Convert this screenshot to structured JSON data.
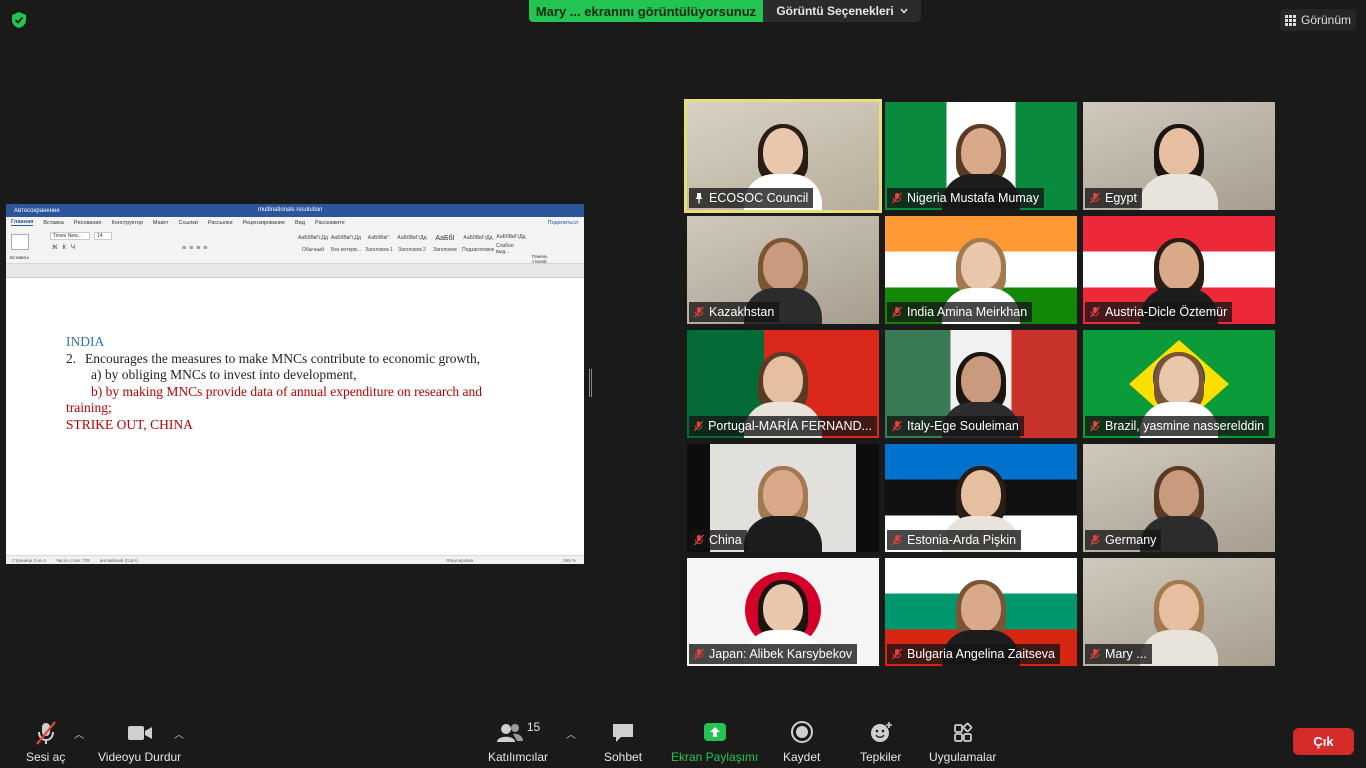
{
  "top": {
    "share_status": "Mary ... ekranını görüntülüyorsunuz",
    "view_options": "Görüntü Seçenekleri",
    "view_button": "Görünüm"
  },
  "document": {
    "filename": "multinationals resolution",
    "autosave": "Автосохранение",
    "tabs": [
      "Главная",
      "Вставка",
      "Рисование",
      "Конструктор",
      "Макет",
      "Ссылки",
      "Рассылки",
      "Рецензирование",
      "Вид",
      "Расскажите"
    ],
    "share_label": "Поделиться",
    "font_name": "Times New...",
    "font_size": "14",
    "styles": [
      {
        "preview": "АаБбВвГг,Дд",
        "name": "Обычный"
      },
      {
        "preview": "АаБбВвГг,Дд",
        "name": "Без интерв..."
      },
      {
        "preview": "АаБбВвГ:",
        "name": "Заголовок 1"
      },
      {
        "preview": "АаБбВвГгДд",
        "name": "Заголовок 2"
      },
      {
        "preview": "АаБбI",
        "name": "Заголовок"
      },
      {
        "preview": "АаБбВвГгДд",
        "name": "Подзаголовок"
      },
      {
        "preview": "АаБбВвГгДд",
        "name": "Слабое выд..."
      }
    ],
    "styles_pane": "Панель стилей",
    "paste_label": "Вставить",
    "status_left": "Страница 2 из 4",
    "status_words": "Число слов: 728",
    "status_lang": "английский (США)",
    "status_focus": "Фокусировка",
    "status_zoom": "265 %",
    "content": {
      "heading": "INDIA",
      "item_number": "2.",
      "item_text": "Encourages the measures to make MNCs contribute to economic growth,",
      "sub_a": "a) by obliging MNCs to invest into development,",
      "sub_b_line1": "b) by making MNCs provide data of annual expenditure on research and",
      "sub_b_line2": "training;",
      "strike_note": "STRIKE OUT, CHINA"
    }
  },
  "participants": [
    {
      "name": "ECOSOC Council",
      "pinned": true,
      "active": true
    },
    {
      "name": "Nigeria Mustafa Mumay",
      "flag": "nigeria"
    },
    {
      "name": "Egypt",
      "flag": "room"
    },
    {
      "name": "Kazakhstan",
      "flag": "room"
    },
    {
      "name": "India Amina Meirkhan",
      "flag": "india"
    },
    {
      "name": "Austria-Dicle Öztemür",
      "flag": "austria"
    },
    {
      "name": "Portugal-MARÍA FERNAND...",
      "flag": "portugal"
    },
    {
      "name": "Italy-Ege Souleiman",
      "flag": "italy"
    },
    {
      "name": "Brazil, yasmine nasserelddin",
      "flag": "brazil"
    },
    {
      "name": "China",
      "flag": "black"
    },
    {
      "name": "Estonia-Arda Pişkin",
      "flag": "estonia"
    },
    {
      "name": "Germany",
      "flag": "room"
    },
    {
      "name": "Japan: Alibek Karsybekov",
      "flag": "japan"
    },
    {
      "name": "Bulgaria Angelina Zaitseva",
      "flag": "bulgaria"
    },
    {
      "name": "Mary ...",
      "flag": "room"
    }
  ],
  "toolbar": {
    "audio": "Sesi aç",
    "video": "Videoyu Durdur",
    "participants": "Katılımcılar",
    "participants_count": "15",
    "chat": "Sohbet",
    "share": "Ekran Paylaşımı",
    "record": "Kaydet",
    "reactions": "Tepkiler",
    "apps": "Uygulamalar",
    "leave": "Çık"
  },
  "colors": {
    "share_green": "#23c552",
    "active_speaker": "#e8df7a",
    "leave_red": "#d52b2b",
    "doc_blue": "#2e75b6",
    "doc_red": "#c00000"
  }
}
